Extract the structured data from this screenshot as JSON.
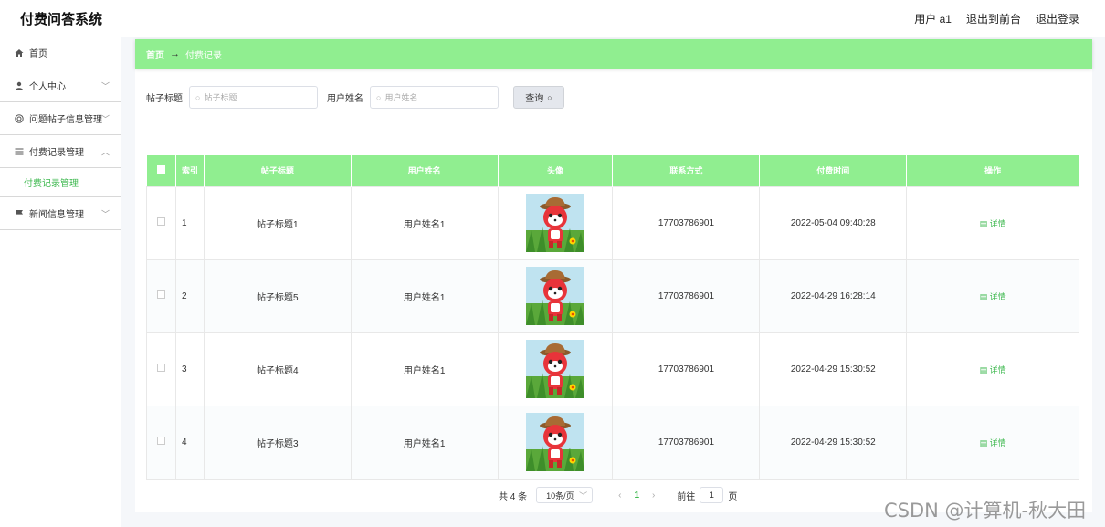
{
  "app": {
    "title": "付费问答系统"
  },
  "top_links": {
    "user": "用户 a1",
    "front": "退出到前台",
    "logout": "退出登录"
  },
  "sidebar": {
    "items": [
      {
        "label": "首页",
        "icon": "home-icon"
      },
      {
        "label": "个人中心",
        "icon": "user-icon"
      },
      {
        "label": "问题帖子信息管理",
        "icon": "help-icon"
      },
      {
        "label": "付费记录管理",
        "icon": "list-icon"
      },
      {
        "label": "新闻信息管理",
        "icon": "flag-icon"
      }
    ],
    "sub_label": "付费记录管理"
  },
  "breadcrumb": {
    "home": "首页",
    "arrow": "→",
    "current": "付费记录"
  },
  "search": {
    "title_label": "帖子标题",
    "title_placeholder": "帖子标题",
    "name_label": "用户姓名",
    "name_placeholder": "用户姓名",
    "button": "查询"
  },
  "table": {
    "headers": [
      "索引",
      "帖子标题",
      "用户姓名",
      "头像",
      "联系方式",
      "付费时间",
      "操作"
    ],
    "rows": [
      {
        "index": "1",
        "title": "帖子标题1",
        "name": "用户姓名1",
        "phone": "17703786901",
        "time": "2022-05-04 09:40:28",
        "action": "详情"
      },
      {
        "index": "2",
        "title": "帖子标题5",
        "name": "用户姓名1",
        "phone": "17703786901",
        "time": "2022-04-29 16:28:14",
        "action": "详情"
      },
      {
        "index": "3",
        "title": "帖子标题4",
        "name": "用户姓名1",
        "phone": "17703786901",
        "time": "2022-04-29 15:30:52",
        "action": "详情"
      },
      {
        "index": "4",
        "title": "帖子标题3",
        "name": "用户姓名1",
        "phone": "17703786901",
        "time": "2022-04-29 15:30:52",
        "action": "详情"
      }
    ]
  },
  "pager": {
    "total": "共 4 条",
    "size": "10条/页",
    "current": "1",
    "goto": "前往",
    "goto_value": "1",
    "page_suffix": "页"
  },
  "watermark": "CSDN @计算机-秋大田",
  "colors": {
    "accent": "#90ee90",
    "link": "#3fb950"
  }
}
